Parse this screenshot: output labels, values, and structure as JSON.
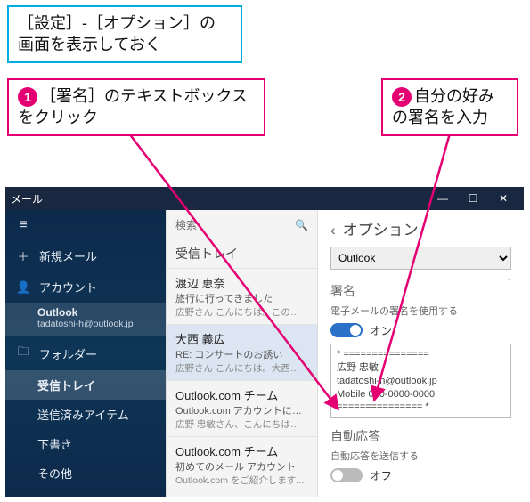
{
  "callouts": {
    "top": "［設定］-［オプション］の\n画面を表示しておく",
    "left_num": "1",
    "left": "［署名］のテキストボックスをクリック",
    "right_num": "2",
    "right": "自分の好みの署名を入力"
  },
  "titlebar": {
    "title": "メール",
    "min": "—",
    "max": "☐",
    "close": "✕"
  },
  "sidebar": {
    "hamburger": "≡",
    "new_icon": "＋",
    "new_label": "新規メール",
    "acct_icon": "👤",
    "acct_label": "アカウント",
    "account": {
      "name": "Outlook",
      "addr": "tadatoshi-h@outlook.jp"
    },
    "folder_icon": "🗀",
    "folder_label": "フォルダー",
    "items": {
      "inbox": "受信トレイ",
      "sent": "送信済みアイテム",
      "drafts": "下書き",
      "other": "その他"
    }
  },
  "msglist": {
    "search": "検索",
    "header": "受信トレイ",
    "items": [
      {
        "from": "渡辺 恵奈",
        "subj": "旅行に行ってきました",
        "prev": "広野さん こんにちは。この間の週末、"
      },
      {
        "from": "大西 義広",
        "subj": "RE: コンサートのお誘い",
        "prev": "広野さん こんにちは。大西です。お誘い"
      },
      {
        "from": "Outlook.com チーム",
        "subj": "Outlook.com アカウントにサインイン",
        "prev": "広野 忠敏さん、こんにちは。引き続き"
      },
      {
        "from": "Outlook.com チーム",
        "subj": "初めてのメール アカウント",
        "prev": "Outlook.com をご紹介します。まず、"
      }
    ]
  },
  "options": {
    "back": "‹",
    "title": "オプション",
    "account_select": "Outlook",
    "collapse": "ˆ",
    "sig_title": "署名",
    "sig_sub": "電子メールの署名を使用する",
    "sig_on": "オン",
    "signature": "* ===============\n    広野 忠敏\n    tadatoshi-h@outlook.jp\n    Mobile 090-0000-0000\n  =============== *",
    "auto_title": "自動応答",
    "auto_sub": "自動応答を送信する",
    "auto_off": "オフ"
  }
}
